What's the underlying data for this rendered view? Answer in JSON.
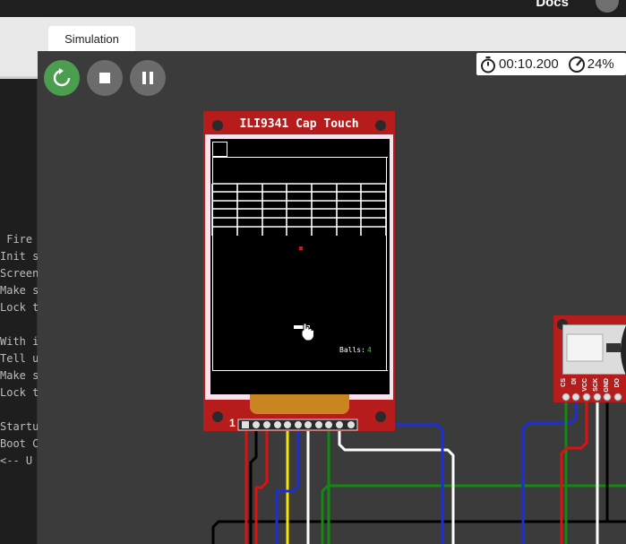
{
  "header": {
    "docs_label": "Docs"
  },
  "tabs": [
    {
      "label": "Simulation"
    }
  ],
  "controls": {
    "restart_icon": "restart-icon",
    "stop_icon": "stop-icon",
    "pause_icon": "pause-icon"
  },
  "status": {
    "timer_icon": "stopwatch-icon",
    "elapsed": "00:10.200",
    "speed_icon": "gauge-icon",
    "speed": "24%"
  },
  "editor_lines": [
    " Fire",
    "Init s",
    "Screen",
    "Make s",
    "Lock t",
    "With i",
    "Tell u",
    "Make s",
    "Lock t",
    "Startu",
    "Boot C",
    "<-- U"
  ],
  "display": {
    "title": "ILI9341 Cap Touch",
    "pin1_label": "1",
    "balls_text": "Balls:",
    "balls_value": "4"
  },
  "sd_module": {
    "pin_labels": [
      "CS",
      "DI",
      "VCC",
      "SCK",
      "GND",
      "DO"
    ]
  },
  "colors": {
    "board_red": "#b71c1c",
    "restart_green": "#4a9e4e",
    "wire_red": "#e01010",
    "wire_blue": "#1d2fd6",
    "wire_green": "#108a10",
    "wire_yellow": "#f2e600",
    "wire_white": "#ffffff",
    "wire_black": "#000000"
  }
}
